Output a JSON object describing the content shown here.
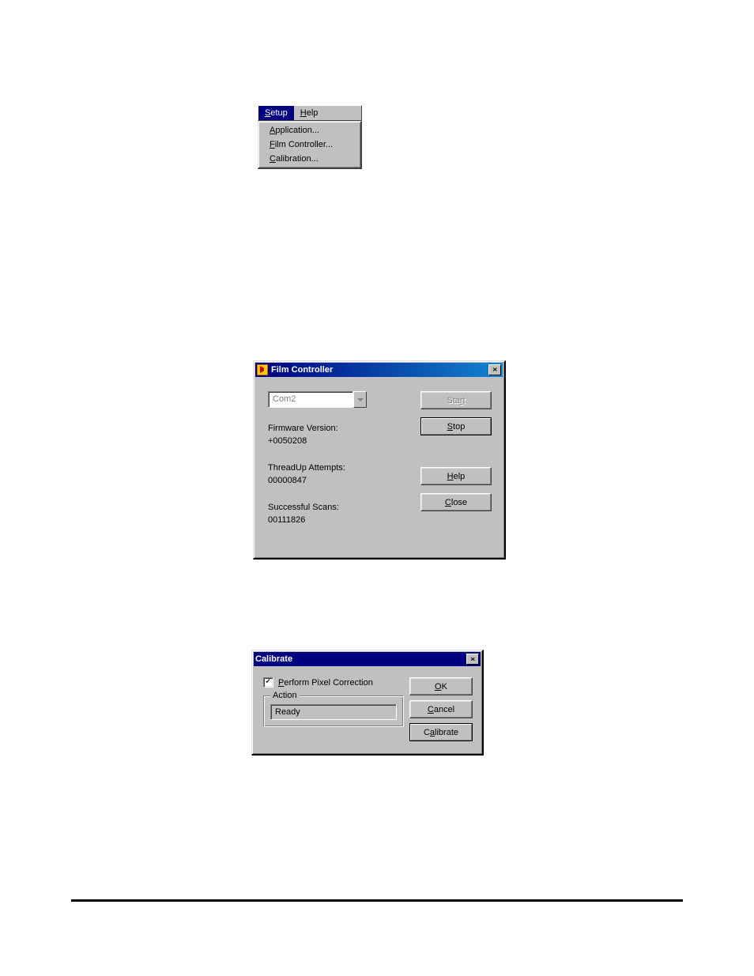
{
  "menu": {
    "bar": {
      "setup": "Setup",
      "help": "Help"
    },
    "items": [
      {
        "label": "Application..."
      },
      {
        "label": "Film Controller..."
      },
      {
        "label": "Calibration..."
      }
    ]
  },
  "film": {
    "title": "Film Controller",
    "port": "Com2",
    "firmware_label": "Firmware Version:",
    "firmware_value": "+0050208",
    "threadup_label": "ThreadUp Attempts:",
    "threadup_value": "00000847",
    "scans_label": "Successful Scans:",
    "scans_value": "00111826",
    "buttons": {
      "start": "Start",
      "stop": "Stop",
      "help": "Help",
      "close": "Close"
    }
  },
  "calibrate": {
    "title": "Calibrate",
    "checkbox": "Perform Pixel Correction",
    "group": "Action",
    "status": "Ready",
    "buttons": {
      "ok": "OK",
      "cancel": "Cancel",
      "calibrate": "Calibrate"
    }
  }
}
